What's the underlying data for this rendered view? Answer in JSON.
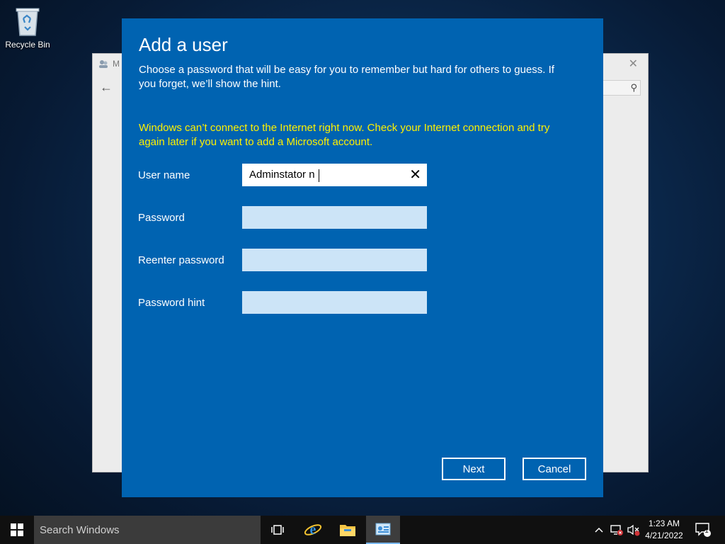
{
  "desktop": {
    "recycle_bin_label": "Recycle Bin"
  },
  "background_window": {
    "title": "M",
    "back_icon": "back-arrow-icon",
    "search_icon": "search-icon"
  },
  "dialog": {
    "title": "Add a user",
    "description": "Choose a password that will be easy for you to remember but hard for others to guess. If you forget, we’ll show the hint.",
    "warning": "Windows can’t connect to the Internet right now. Check your Internet connection and try again later if you want to add a Microsoft account.",
    "warning_color": "#fff100",
    "background_color": "#0063b1",
    "fields": {
      "user_name": {
        "label": "User name",
        "value": "Adminstator n"
      },
      "password": {
        "label": "Password",
        "value": ""
      },
      "reenter_password": {
        "label": "Reenter password",
        "value": ""
      },
      "password_hint": {
        "label": "Password hint",
        "value": ""
      }
    },
    "buttons": {
      "next": "Next",
      "cancel": "Cancel"
    }
  },
  "taskbar": {
    "search_placeholder": "Search Windows",
    "apps": [
      "task-view-icon",
      "internet-explorer-icon",
      "file-explorer-icon",
      "control-panel-icon"
    ],
    "clock": {
      "time": "1:23 AM",
      "date": "4/21/2022"
    },
    "notification_count": "1"
  }
}
